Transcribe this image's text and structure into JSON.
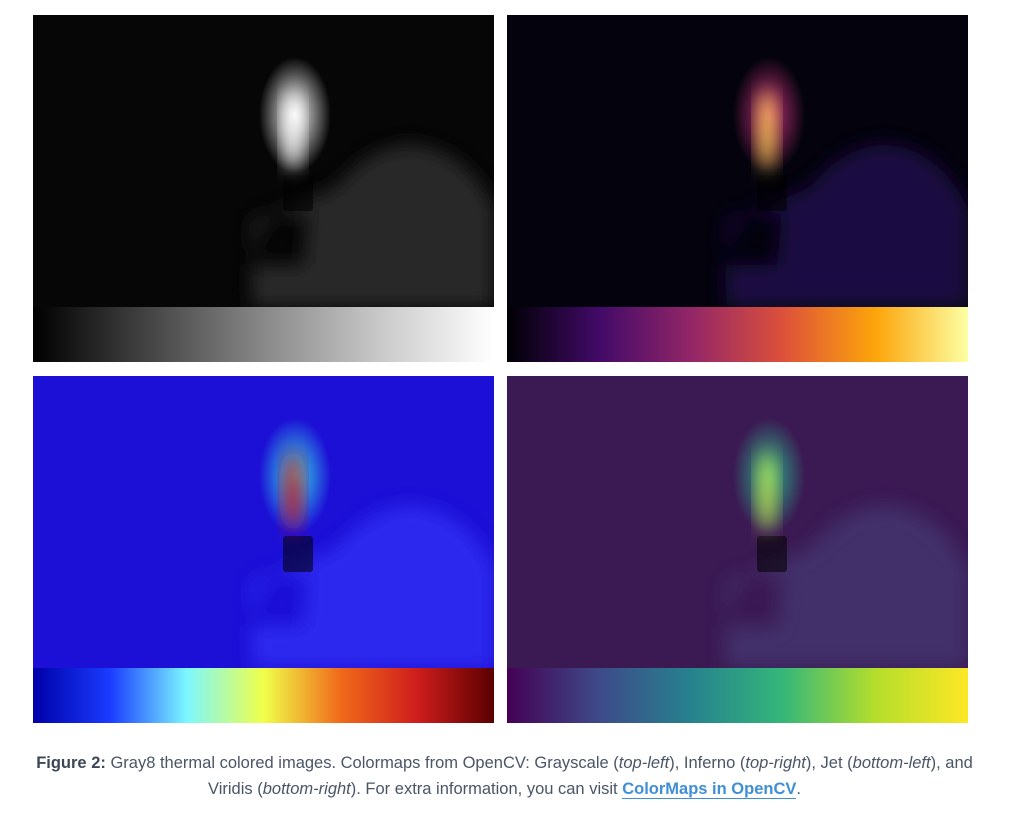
{
  "panels": [
    {
      "id": "gray",
      "colormap": "Grayscale",
      "position": "top-left",
      "colors": {
        "bg": "#060606",
        "hand": "#2a2a2a",
        "glow": "#ffffff",
        "core": "#ffffff",
        "bar": [
          "#000000",
          "#444444",
          "#888888",
          "#c8c8c8",
          "#ffffff"
        ]
      }
    },
    {
      "id": "inferno",
      "colormap": "Inferno",
      "position": "top-right",
      "colors": {
        "bg": "#04030d",
        "hand": "#1c0c45",
        "glow": "#c2307a",
        "core": "#fcd34d",
        "bar": [
          "#000004",
          "#420a68",
          "#932667",
          "#dd513a",
          "#fca50a",
          "#fcffa4"
        ]
      }
    },
    {
      "id": "jet",
      "colormap": "Jet",
      "position": "bottom-left",
      "colors": {
        "bg": "#1c10d6",
        "hand": "#2d2bf0",
        "glow": "#37e0e8",
        "core": "#d41414",
        "bar": [
          "#0000a8",
          "#1a3bff",
          "#7cf7ff",
          "#f0ff4a",
          "#f06a1a",
          "#cf1d1d",
          "#5a0000"
        ]
      }
    },
    {
      "id": "viridis",
      "colormap": "Viridis",
      "position": "bottom-right",
      "colors": {
        "bg": "#3b1a53",
        "hand": "#42306c",
        "glow": "#2bb08a",
        "core": "#c7e24a",
        "bar": [
          "#440154",
          "#3e4a89",
          "#26828e",
          "#35b779",
          "#b5de2b",
          "#fde725"
        ]
      }
    }
  ],
  "caption": {
    "label": "Figure 2:",
    "text_1": " Gray8 thermal colored images. Colormaps from OpenCV: Grayscale (",
    "pos_1": "top-left",
    "text_2": "), Inferno (",
    "pos_2": "top-right",
    "text_3": "), Jet (",
    "pos_3": "bottom-left",
    "text_4": "), and Viridis (",
    "pos_4": "bottom-right",
    "text_5": "). For extra information, you can visit ",
    "link_text": "ColorMaps in OpenCV",
    "text_6": "."
  }
}
